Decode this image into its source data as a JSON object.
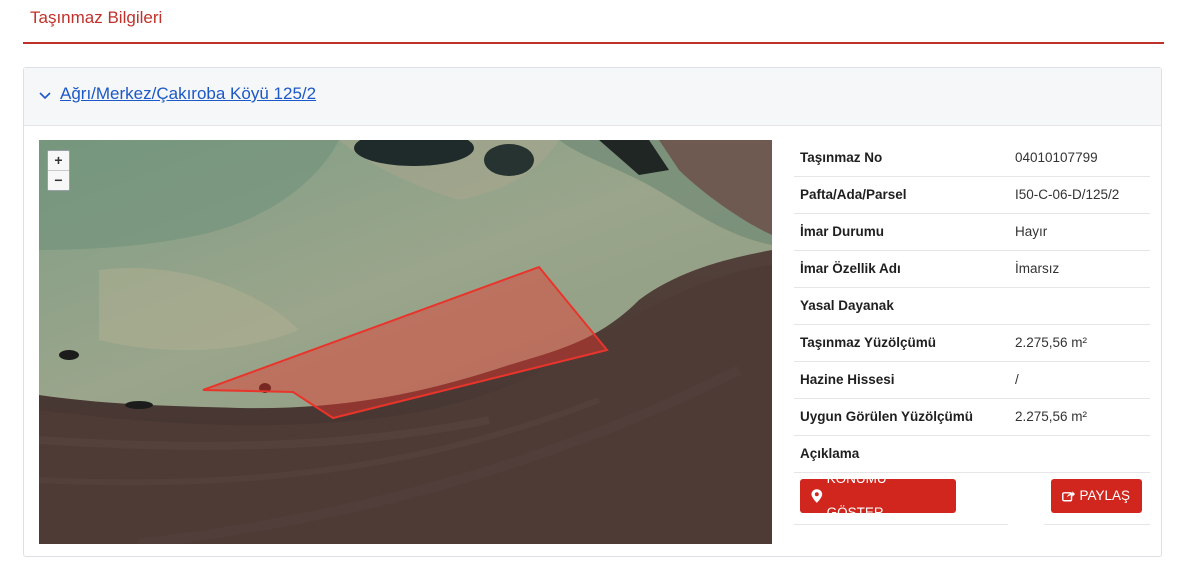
{
  "page": {
    "title": "Taşınmaz Bilgileri"
  },
  "card": {
    "parcel_link": "Ağrı/Merkez/Çakıroba Köyü 125/2"
  },
  "map": {
    "zoom_in": "+",
    "zoom_out": "−",
    "parcel_color": "#e8352c"
  },
  "details": [
    {
      "label": "Taşınmaz No",
      "value": "04010107799"
    },
    {
      "label": "Pafta/Ada/Parsel",
      "value": "I50-C-06-D/125/2"
    },
    {
      "label": "İmar Durumu",
      "value": "Hayır"
    },
    {
      "label": "İmar Özellik Adı",
      "value": "İmarsız"
    },
    {
      "label": "Yasal Dayanak",
      "value": ""
    },
    {
      "label": "Taşınmaz Yüzölçümü",
      "value": "2.275,56 m²"
    },
    {
      "label": "Hazine Hissesi",
      "value": "/"
    },
    {
      "label": "Uygun Görülen Yüzölçümü",
      "value": "2.275,56 m²"
    },
    {
      "label": "Açıklama",
      "value": ""
    }
  ],
  "buttons": {
    "show_location": "KONUMU GÖSTER",
    "share": "PAYLAŞ"
  },
  "colors": {
    "accent": "#c0312b",
    "button": "#d0261d",
    "link": "#1c58c7"
  }
}
